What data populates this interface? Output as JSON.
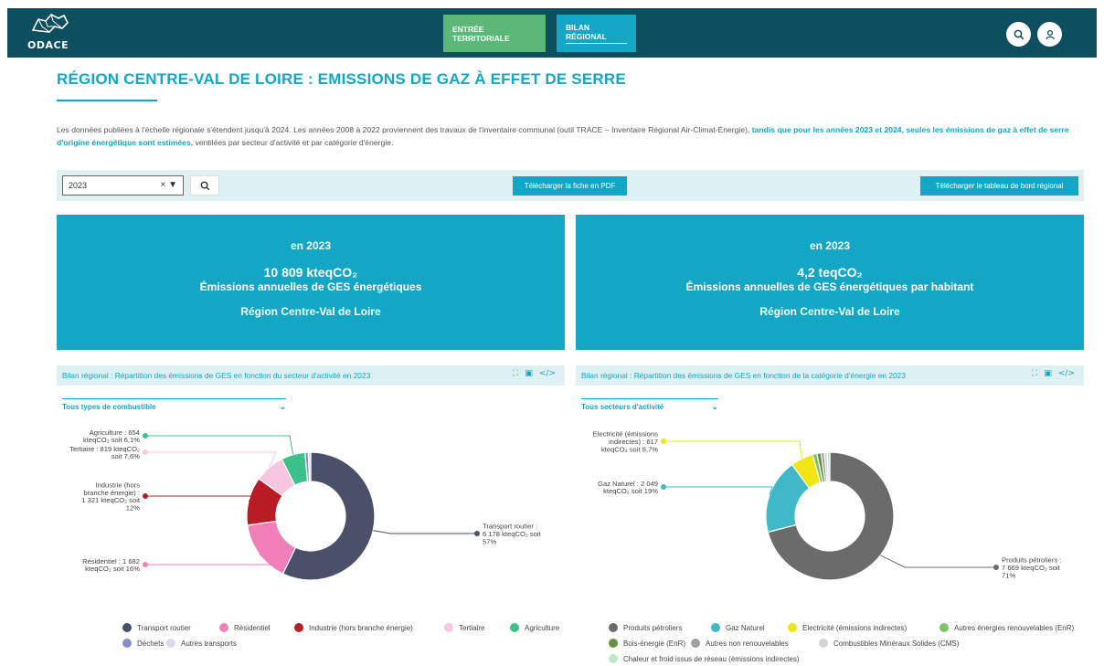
{
  "header": {
    "logo_text": "ODACE",
    "nav": [
      {
        "label": "ENTRÉE TERRITORIALE"
      },
      {
        "label": "BILAN RÉGIONAL"
      }
    ]
  },
  "page_title": "RÉGION CENTRE-VAL DE LOIRE : EMISSIONS DE GAZ À EFFET DE SERRE",
  "intro": {
    "part1": "Les données publiées à l'échelle régionale s'étendent jusqu'à 2024. Les années 2008 à 2022 proviennent des travaux de l'inventaire communal (outil TRACE – Inventaire Régional Air-Climat-Énergie), ",
    "bold": "tandis que pour les années 2023 et 2024, seules les émissions de gaz à effet de serre d'origine énergétique sont estimées,",
    "part2": " ventilées par secteur d'activité et par catégorie d'énergie."
  },
  "toolbar": {
    "year_value": "2023",
    "clear": "×",
    "caret": "▼",
    "pdf_label": "Télécharger la fiche en PDF",
    "dashboard_label": "Télécharger le tableau de bord régional"
  },
  "kpi": [
    {
      "year": "en 2023",
      "value": "10 809 kteqCO₂",
      "label": "Émissions annuelles de GES énergétiques",
      "region": "Région Centre-Val de Loire"
    },
    {
      "year": "en 2023",
      "value": "4,2 teqCO₂",
      "label": "Émissions annuelles de GES énergétiques par habitant",
      "region": "Région Centre-Val de Loire"
    }
  ],
  "panels": [
    {
      "title": "Bilan régional : Répartition des émissions de GES en fonction du secteur d'activité en 2023",
      "filter": "Tous types de combustible"
    },
    {
      "title": "Bilan régional : Répartition des émissions de GES en fonction de la catégorie d'énergie en 2023",
      "filter": "Tous secteurs d'activité"
    }
  ],
  "colors": {
    "Transport routier": "#4a4f6a",
    "Résidentiel": "#f180b8",
    "Industrie (hors branche énergie)": "#b81c24",
    "Tertiaire": "#f8c6df",
    "Agriculture": "#3cc18a",
    "Déchets": "#8c8cc8",
    "Autres transports": "#d9d9e8",
    "Produits pétroliers": "#6b6b6b",
    "Gaz Naturel": "#3fb8c8",
    "Electricité (émissions indirectes)": "#f1e614",
    "Autres énergies renouvelables (EnR)": "#7dc36a",
    "Bois-énergie (EnR)": "#6e8b3d",
    "Autres non renouvelables": "#a0a0a0",
    "Combustibles Minéraux Solides (CMS)": "#d4d4d4",
    "Chaleur et froid issus de réseau (émissions indirectes)": "#bde8c8"
  },
  "chart_data": [
    {
      "type": "pie",
      "unit": "kteqCO₂",
      "categories": [
        "Transport routier",
        "Résidentiel",
        "Industrie (hors branche énergie)",
        "Tertiaire",
        "Agriculture",
        "Déchets",
        "Autres transports"
      ],
      "values": [
        6178,
        1682,
        1321,
        819,
        654,
        90,
        65
      ],
      "labels": [
        {
          "lines": [
            "Transport routier :",
            "6 178 kteqCO₂ soit",
            "57%"
          ]
        },
        {
          "lines": [
            "Résidentiel : 1 682",
            "kteqCO₂ soit 16%"
          ]
        },
        {
          "lines": [
            "Industrie (hors",
            "branche énergie) :",
            "1 321 kteqCO₂ soit",
            "12%"
          ]
        },
        {
          "lines": [
            "Tertiaire : 819 kteqCO₂",
            "soit 7,6%"
          ]
        },
        {
          "lines": [
            "Agriculture : 654",
            "kteqCO₂ soit 6,1%"
          ]
        }
      ],
      "legend": [
        "Transport routier",
        "Résidentiel",
        "Industrie (hors branche énergie)",
        "Tertiaire",
        "Agriculture",
        "Déchets",
        "Autres transports"
      ]
    },
    {
      "type": "pie",
      "unit": "kteqCO₂",
      "categories": [
        "Produits pétroliers",
        "Gaz Naturel",
        "Electricité (émissions indirectes)",
        "Autres énergies renouvelables (EnR)",
        "Bois-énergie (EnR)",
        "Autres non renouvelables",
        "Combustibles Minéraux Solides (CMS)",
        "Chaleur et froid issus de réseau (émissions indirectes)"
      ],
      "values": [
        7669,
        2049,
        617,
        120,
        110,
        90,
        80,
        70
      ],
      "labels": [
        {
          "lines": [
            "Produits pétroliers :",
            "7 669 kteqCO₂ soit",
            "71%"
          ]
        },
        {
          "lines": [
            "Gaz Naturel : 2 049",
            "kteqCO₂ soit 19%"
          ]
        },
        {
          "lines": [
            "Electricité (émissions",
            "indirectes) : 617",
            "kteqCO₂ soit 5,7%"
          ]
        }
      ],
      "legend": [
        "Produits pétroliers",
        "Gaz Naturel",
        "Electricité (émissions indirectes)",
        "Autres énergies renouvelables (EnR)",
        "Bois-énergie (EnR)",
        "Autres non renouvelables",
        "Combustibles Minéraux Solides (CMS)",
        "Chaleur et froid issus de réseau (émissions indirectes)"
      ]
    }
  ]
}
